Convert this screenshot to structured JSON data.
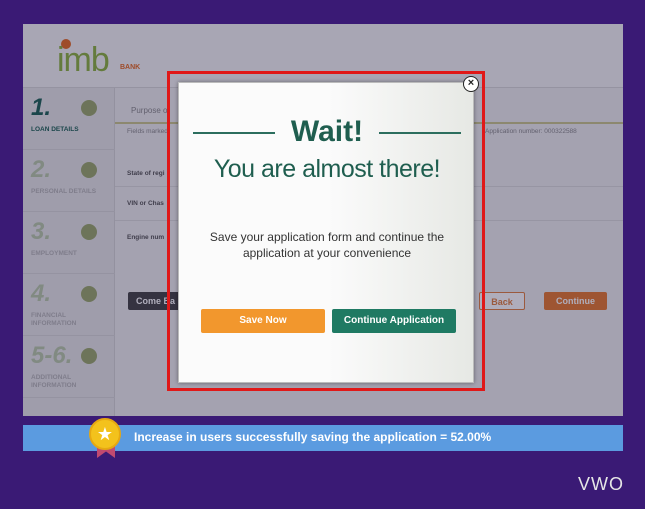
{
  "app": {
    "logo_text": "imb",
    "logo_sub": "BANK"
  },
  "sidebar": {
    "steps": [
      {
        "number": "1.",
        "label": "LOAN DETAILS"
      },
      {
        "number": "2.",
        "label": "PERSONAL DETAILS"
      },
      {
        "number": "3.",
        "label": "EMPLOYMENT"
      },
      {
        "number": "4.",
        "label": "FINANCIAL INFORMATION"
      },
      {
        "number": "5-6.",
        "label": "ADDITIONAL INFORMATION"
      }
    ]
  },
  "form": {
    "purpose_label": "Purpose of",
    "fields_note": "Fields marked",
    "application_number": "Application number: 000322588",
    "rows": [
      "State of regi",
      "VIN or Chas",
      "Engine num"
    ],
    "come_back_label": "Come Ba",
    "back_label": "Back",
    "continue_label": "Continue"
  },
  "modal": {
    "title": "Wait!",
    "subtitle": "You are almost there!",
    "message": "Save your application form and continue the application at your convenience",
    "save_now_label": "Save Now",
    "continue_application_label": "Continue Application",
    "close_symbol": "×"
  },
  "banner": {
    "text": "Increase in users successfully saving the application = 52.00%",
    "medal_icon": "★"
  },
  "brand": {
    "watermark": "VWO"
  },
  "colors": {
    "background": "#3a1a75",
    "highlight_border": "#e01818",
    "save_now": "#f2972d",
    "continue_application": "#1f7a63",
    "banner": "#5b9be0"
  }
}
